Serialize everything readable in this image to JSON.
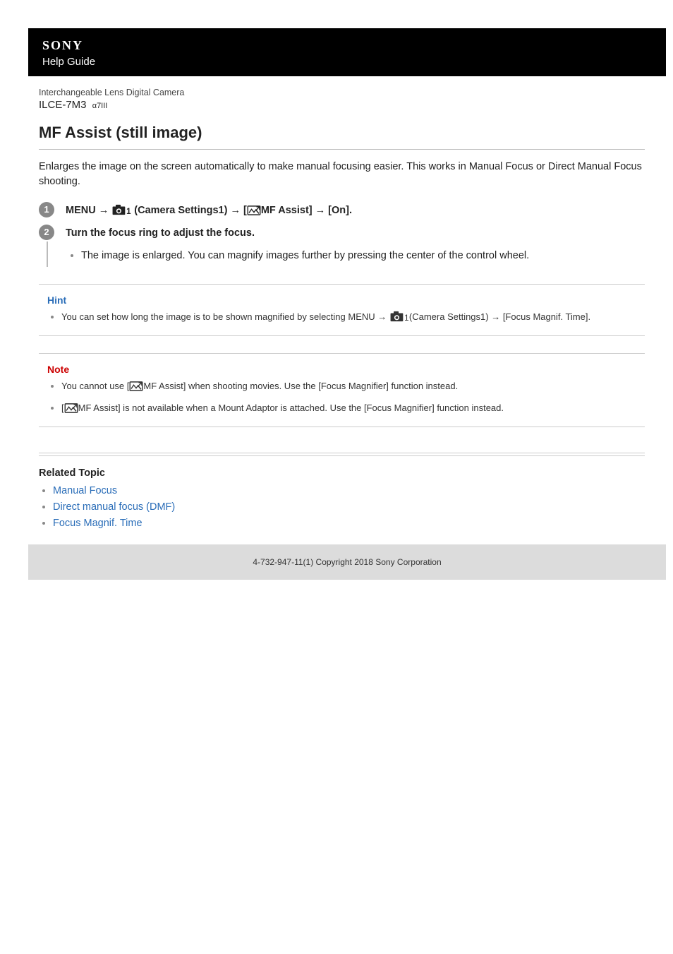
{
  "brand": "SONY",
  "header_sub": "Help Guide",
  "product_line": "Interchangeable Lens Digital Camera",
  "product_model": "ILCE-7M3",
  "product_suffix": "α7III",
  "page_title": "MF Assist (still image)",
  "intro": "Enlarges the image on the screen automatically to make manual focusing easier. This works in Manual Focus or Direct Manual Focus shooting.",
  "steps": [
    {
      "num": "1",
      "head_pre": "MENU → ",
      "head_mid1": " (Camera Settings1) → [",
      "head_mid2": "MF Assist] → [On].",
      "bullets": []
    },
    {
      "num": "2",
      "head": "Turn the focus ring to adjust the focus.",
      "bullets": [
        "The image is enlarged. You can magnify images further by pressing the center of the control wheel."
      ]
    }
  ],
  "hint": {
    "label": "Hint",
    "items_pre": "You can set how long the image is to be shown magnified by selecting MENU → ",
    "items_post": "(Camera Settings1) → [Focus Magnif. Time]."
  },
  "note": {
    "label": "Note",
    "item1_pre": "You cannot use [",
    "item1_post": "MF Assist] when shooting movies. Use the [Focus Magnifier] function instead.",
    "item2_pre": "[",
    "item2_post": "MF Assist] is not available when a Mount Adaptor is attached. Use the [Focus Magnifier] function instead."
  },
  "related": {
    "title": "Related Topic",
    "links": [
      "Manual Focus",
      "Direct manual focus (DMF)",
      "Focus Magnif. Time"
    ]
  },
  "footer": "4-732-947-11(1) Copyright 2018 Sony Corporation"
}
